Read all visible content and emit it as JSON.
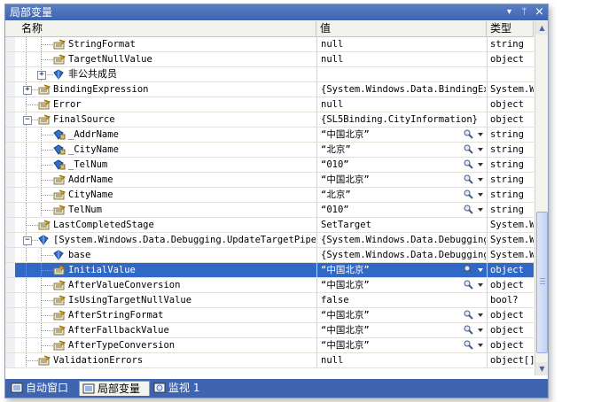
{
  "window": {
    "title": "局部变量",
    "pin": "ᛘ",
    "close": "×",
    "dropdown": "▾"
  },
  "header": {
    "name": "名称",
    "value": "值",
    "type": "类型"
  },
  "rows": [
    {
      "name": "StringFormat",
      "value": "null",
      "type": "string",
      "icon": "property-icon",
      "indent": 3,
      "expander": "none",
      "sel": false,
      "mag": false
    },
    {
      "name": "TargetNullValue",
      "value": "null",
      "type": "object",
      "icon": "property-icon",
      "indent": 3,
      "expander": "none",
      "sel": false,
      "mag": false
    },
    {
      "name": "非公共成员",
      "value": "",
      "type": "",
      "icon": "field-icon",
      "indent": 3,
      "expander": "plus",
      "sel": false,
      "mag": false
    },
    {
      "name": "BindingExpression",
      "value": "{System.Windows.Data.BindingExp",
      "type": "System.W",
      "icon": "property-icon",
      "indent": 2,
      "expander": "plus",
      "sel": false,
      "mag": false
    },
    {
      "name": "Error",
      "value": "null",
      "type": "object",
      "icon": "property-icon",
      "indent": 2,
      "expander": "none",
      "sel": false,
      "mag": false
    },
    {
      "name": "FinalSource",
      "value": "{SL5Binding.CityInformation}",
      "type": "object",
      "icon": "property-icon",
      "indent": 2,
      "expander": "minus",
      "sel": false,
      "mag": false
    },
    {
      "name": "_AddrName",
      "value": "“中国北京”",
      "type": "string",
      "icon": "field-lock-icon",
      "indent": 3,
      "expander": "none",
      "sel": false,
      "mag": true
    },
    {
      "name": "_CityName",
      "value": "“北京”",
      "type": "string",
      "icon": "field-lock-icon",
      "indent": 3,
      "expander": "none",
      "sel": false,
      "mag": true
    },
    {
      "name": "_TelNum",
      "value": "“010”",
      "type": "string",
      "icon": "field-lock-icon",
      "indent": 3,
      "expander": "none",
      "sel": false,
      "mag": true
    },
    {
      "name": "AddrName",
      "value": "“中国北京”",
      "type": "string",
      "icon": "property-icon",
      "indent": 3,
      "expander": "none",
      "sel": false,
      "mag": true
    },
    {
      "name": "CityName",
      "value": "“北京”",
      "type": "string",
      "icon": "property-icon",
      "indent": 3,
      "expander": "none",
      "sel": false,
      "mag": true
    },
    {
      "name": "TelNum",
      "value": "“010”",
      "type": "string",
      "icon": "property-icon",
      "indent": 3,
      "expander": "none",
      "sel": false,
      "mag": true
    },
    {
      "name": "LastCompletedStage",
      "value": "SetTarget",
      "type": "System.W",
      "icon": "property-icon",
      "indent": 2,
      "expander": "none",
      "sel": false,
      "mag": false
    },
    {
      "name": "[System.Windows.Data.Debugging.UpdateTargetPipeZ",
      "value": "{System.Windows.Data.Debugging.",
      "type": "System.W",
      "icon": "field-icon",
      "indent": 2,
      "expander": "minus",
      "sel": false,
      "mag": false
    },
    {
      "name": "base",
      "value": "{System.Windows.Data.Debugging.",
      "type": "System.W",
      "icon": "field-icon",
      "indent": 3,
      "expander": "none",
      "sel": false,
      "mag": false
    },
    {
      "name": "InitialValue",
      "value": "“中国北京”",
      "type": "object",
      "icon": "property-icon",
      "indent": 3,
      "expander": "none",
      "sel": true,
      "mag": true
    },
    {
      "name": "AfterValueConversion",
      "value": "“中国北京”",
      "type": "object",
      "icon": "property-icon",
      "indent": 3,
      "expander": "none",
      "sel": false,
      "mag": true
    },
    {
      "name": "IsUsingTargetNullValue",
      "value": "false",
      "type": "bool?",
      "icon": "property-icon",
      "indent": 3,
      "expander": "none",
      "sel": false,
      "mag": false
    },
    {
      "name": "AfterStringFormat",
      "value": "“中国北京”",
      "type": "object",
      "icon": "property-icon",
      "indent": 3,
      "expander": "none",
      "sel": false,
      "mag": true
    },
    {
      "name": "AfterFallbackValue",
      "value": "“中国北京”",
      "type": "object",
      "icon": "property-icon",
      "indent": 3,
      "expander": "none",
      "sel": false,
      "mag": true
    },
    {
      "name": "AfterTypeConversion",
      "value": "“中国北京”",
      "type": "object",
      "icon": "property-icon",
      "indent": 3,
      "expander": "none",
      "sel": false,
      "mag": true
    },
    {
      "name": "ValidationErrors",
      "value": "null",
      "type": "object[]",
      "icon": "property-icon",
      "indent": 2,
      "expander": "none",
      "sel": false,
      "mag": false
    }
  ],
  "tabs": [
    {
      "label": "自动窗口",
      "icon": "autos-icon",
      "active": false
    },
    {
      "label": "局部变量",
      "icon": "locals-icon",
      "active": true
    },
    {
      "label": "监视 1",
      "icon": "watch-icon",
      "active": false
    }
  ]
}
